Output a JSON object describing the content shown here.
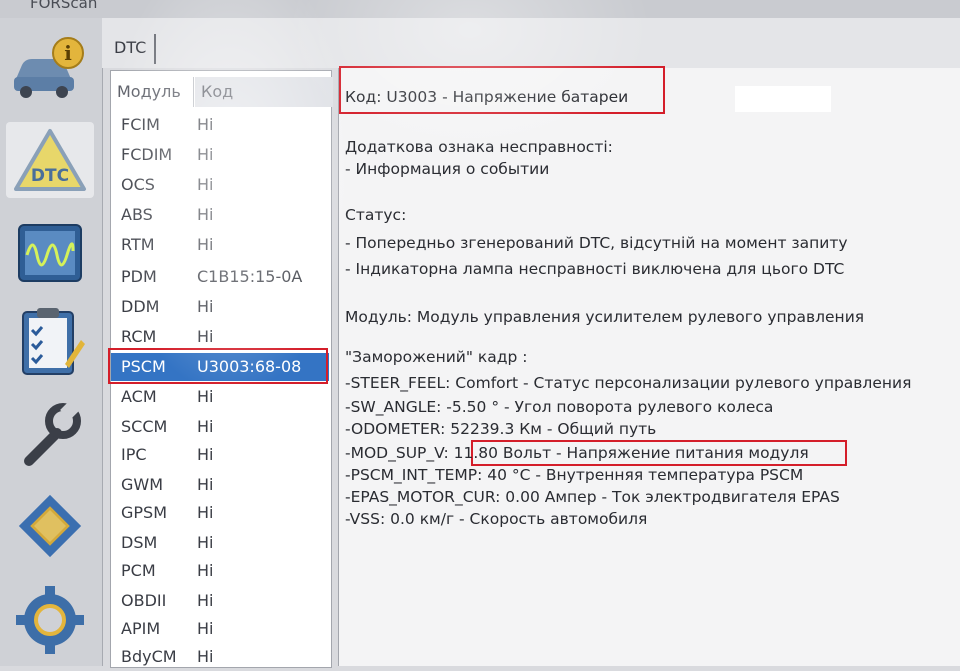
{
  "window": {
    "title": "FORScan"
  },
  "sidebar": {
    "items": [
      {
        "name": "vehicle-info",
        "icon": "car-info-icon"
      },
      {
        "name": "dtc",
        "icon": "dtc-warning-icon",
        "label": "DTC"
      },
      {
        "name": "oscilloscope",
        "icon": "oscilloscope-icon"
      },
      {
        "name": "tests",
        "icon": "checklist-icon"
      },
      {
        "name": "service",
        "icon": "wrench-icon"
      },
      {
        "name": "configuration",
        "icon": "chip-icon"
      },
      {
        "name": "settings",
        "icon": "gear-icon"
      }
    ]
  },
  "tabs": [
    {
      "label": "DTC"
    }
  ],
  "module_table": {
    "headers": {
      "module": "Модуль",
      "code": "Код"
    },
    "rows": [
      {
        "module": "FCIM",
        "code": "Hi"
      },
      {
        "module": "FCDIM",
        "code": "Hi"
      },
      {
        "module": "OCS",
        "code": "Hi"
      },
      {
        "module": "ABS",
        "code": "Hi"
      },
      {
        "module": "RTM",
        "code": "Hi"
      },
      {
        "module": "PDM",
        "code": "C1B15:15-0A"
      },
      {
        "module": "DDM",
        "code": "Hi"
      },
      {
        "module": "RCM",
        "code": "Hi"
      },
      {
        "module": "PSCM",
        "code": "U3003:68-08",
        "selected": true
      },
      {
        "module": "ACM",
        "code": "Hi"
      },
      {
        "module": "SCCM",
        "code": "Hi"
      },
      {
        "module": "IPC",
        "code": "Hi"
      },
      {
        "module": "GWM",
        "code": "Hi"
      },
      {
        "module": "GPSM",
        "code": "Hi"
      },
      {
        "module": "DSM",
        "code": "Hi"
      },
      {
        "module": "PCM",
        "code": "Hi"
      },
      {
        "module": "OBDII",
        "code": "Hi"
      },
      {
        "module": "APIM",
        "code": "Hi"
      },
      {
        "module": "BdyCM",
        "code": "Hi"
      }
    ]
  },
  "details": {
    "code_line": "Код: U3003 - Напряжение батареи",
    "extra_title": "Додаткова ознака несправності:",
    "extra_items": [
      " - Информация о событии"
    ],
    "status_title": "Статус:",
    "status_items": [
      " - Попередньо згенерований DTC, відсутній на момент запиту",
      " - Індикаторна лампа несправності виключена для цього DTC"
    ],
    "module_line": "Модуль: Модуль управления усилителем рулевого управления",
    "freeze_title": " \"Заморожений\" кадр :",
    "freeze_lines": [
      "-STEER_FEEL: Comfort  - Статус персонализации рулевого управления",
      "-SW_ANGLE: -5.50 ° - Угол поворота рулевого колеса",
      "-ODOMETER: 52239.3 Км - Общий путь",
      {
        "prefix": "-MOD_SUP_V: ",
        "value": "11.80 Вольт - Напряжение питания модуля"
      },
      "-PSCM_INT_TEMP: 40 °C - Внутренняя температура PSCM",
      "-EPAS_MOTOR_CUR: 0.00 Ампер - Ток электродвигателя EPAS",
      "-VSS: 0.0 км/г - Скорость автомобиля"
    ]
  },
  "colors": {
    "highlight": "#d41e2a",
    "selection": "#3474c4"
  }
}
